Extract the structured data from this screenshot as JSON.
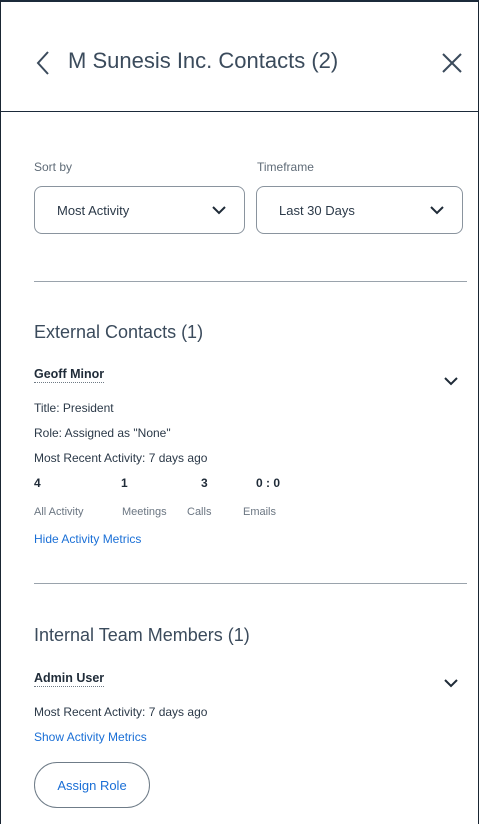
{
  "header": {
    "title": "M Sunesis Inc. Contacts (2)",
    "back_icon": "chevron-left-icon",
    "close_icon": "close-icon"
  },
  "filters": {
    "sort_label": "Sort by",
    "sort_value": "Most Activity",
    "timeframe_label": "Timeframe",
    "timeframe_value": "Last 30 Days"
  },
  "external": {
    "title": "External Contacts (1)",
    "contact": {
      "name": "Geoff Minor",
      "title_line": "Title: President",
      "role_line": "Role: Assigned as \"None\"",
      "recent_line": "Most Recent Activity: 7 days ago",
      "metrics": [
        {
          "value": "4",
          "label": "All Activity"
        },
        {
          "value": "1",
          "label": "Meetings"
        },
        {
          "value": "3",
          "label": "Calls"
        },
        {
          "value": "0 : 0",
          "label": "Emails"
        }
      ],
      "toggle_link": "Hide Activity Metrics"
    }
  },
  "internal": {
    "title": "Internal Team Members (1)",
    "member": {
      "name": "Admin User",
      "recent_line": "Most Recent Activity: 7 days ago",
      "toggle_link": "Show Activity Metrics"
    },
    "assign_button": "Assign Role"
  },
  "colors": {
    "accent_link": "#1a6fd6",
    "text_dark": "#2b3948",
    "border": "#8a949e"
  }
}
